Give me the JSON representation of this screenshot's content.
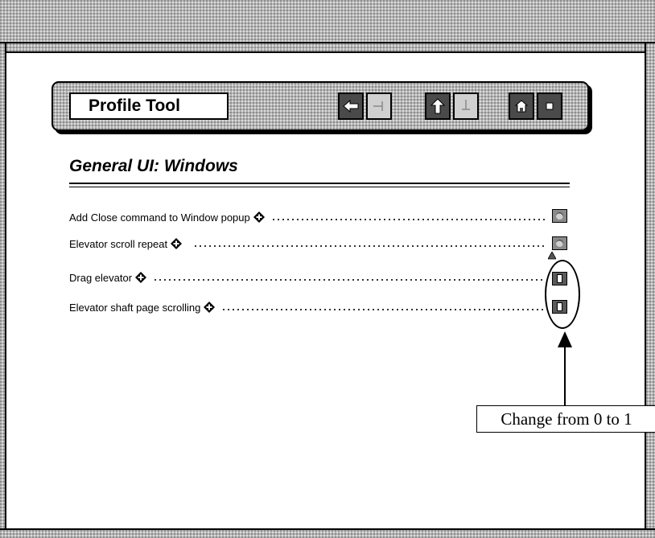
{
  "app": {
    "title": "Profile Tool"
  },
  "toolbar": {
    "buttons": [
      {
        "icon": "back-arrow-icon",
        "enabled": true
      },
      {
        "icon": "forward-arrow-icon",
        "enabled": false
      },
      {
        "icon": "up-arrow-icon",
        "enabled": true
      },
      {
        "icon": "down-arrow-icon",
        "enabled": false
      },
      {
        "icon": "home-icon",
        "enabled": true
      },
      {
        "icon": "stop-icon",
        "enabled": true
      }
    ]
  },
  "page": {
    "heading": "General UI: Windows"
  },
  "options": [
    {
      "label": "Add Close command to Window popup",
      "value": 0
    },
    {
      "label": "Elevator scroll repeat",
      "value": 0
    },
    {
      "label": "Drag elevator",
      "value": 1
    },
    {
      "label": "Elevator shaft page scrolling",
      "value": 1
    }
  ],
  "annotation": {
    "callout": "Change from 0 to 1"
  },
  "colors": {
    "frame_gray": "#b4b4b4",
    "button_dark": "#4a4a4a",
    "button_light": "#d0d0d0"
  }
}
